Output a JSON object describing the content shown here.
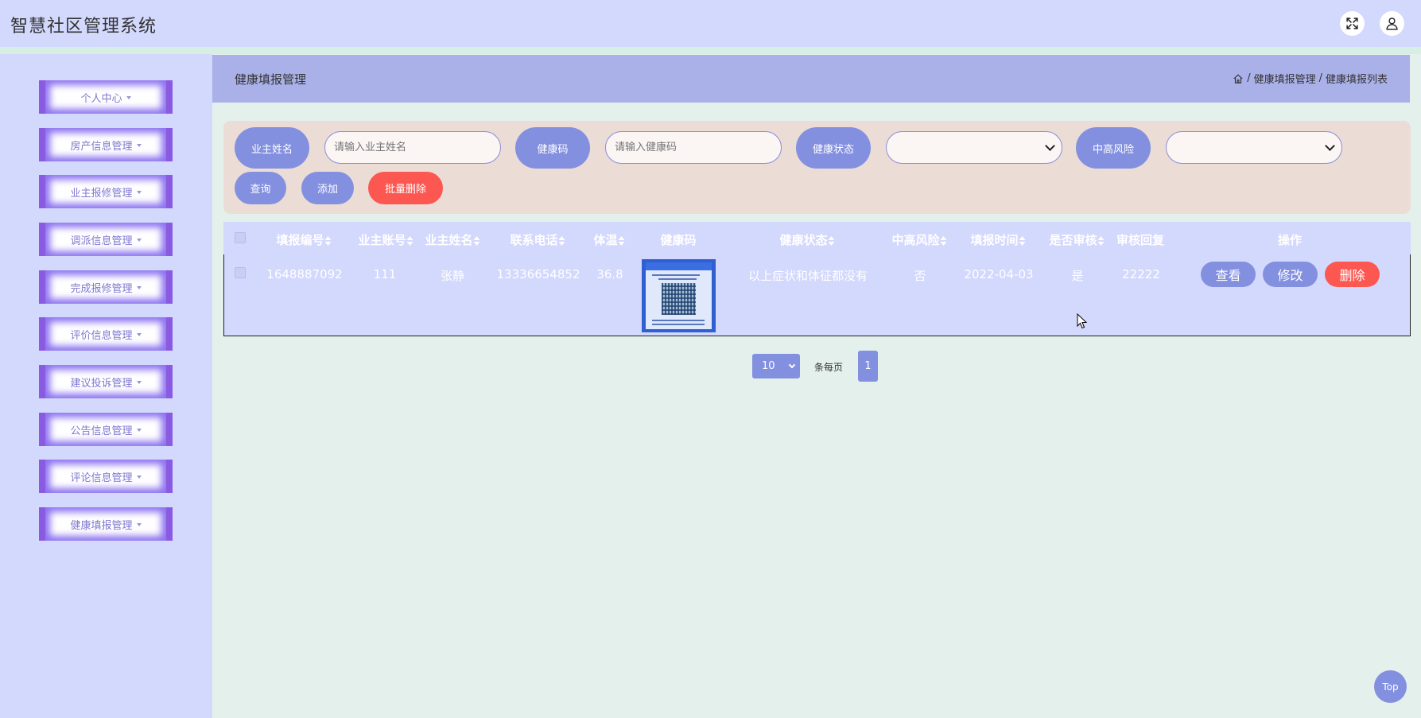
{
  "app": {
    "title": "智慧社区管理系统"
  },
  "sidebar": {
    "items": [
      {
        "label": "个人中心"
      },
      {
        "label": "房产信息管理"
      },
      {
        "label": "业主报修管理"
      },
      {
        "label": "调派信息管理"
      },
      {
        "label": "完成报修管理"
      },
      {
        "label": "评价信息管理"
      },
      {
        "label": "建议投诉管理"
      },
      {
        "label": "公告信息管理"
      },
      {
        "label": "评论信息管理"
      },
      {
        "label": "健康填报管理"
      }
    ]
  },
  "header": {
    "title": "健康填报管理",
    "breadcrumb": [
      "健康填报管理",
      "健康填报列表"
    ],
    "separator": "/"
  },
  "search": {
    "owner_name_label": "业主姓名",
    "owner_name_placeholder": "请输入业主姓名",
    "health_code_label": "健康码",
    "health_code_placeholder": "请输入健康码",
    "health_status_label": "健康状态",
    "health_status_value": "",
    "risk_label": "中高风险",
    "risk_value": "",
    "query_label": "查询",
    "add_label": "添加",
    "batch_delete_label": "批量删除"
  },
  "table": {
    "columns": [
      "填报编号",
      "业主账号",
      "业主姓名",
      "联系电话",
      "体温",
      "健康码",
      "健康状态",
      "中高风险",
      "填报时间",
      "是否审核",
      "审核回复",
      "操作"
    ],
    "rows": [
      {
        "report_no": "1648887092",
        "account": "111",
        "name": "张静",
        "phone": "13336654852",
        "temperature": "36.8",
        "health_status": "以上症状和体征都没有",
        "risk": "否",
        "report_time": "2022-04-03",
        "audited": "是",
        "audit_reply": "22222"
      }
    ],
    "actions": {
      "view": "查看",
      "edit": "修改",
      "delete": "删除"
    }
  },
  "pagination": {
    "page_size": "10",
    "per_page_label": "条每页",
    "current_page": "1"
  },
  "back_to_top": "Top",
  "colors": {
    "topbar": "#d3d8fd",
    "accent": "#8390e0",
    "danger": "#fc5750",
    "header_band": "#aab1e9",
    "search_panel": "#ebdcd5",
    "page_bg": "#e4f0ec"
  }
}
